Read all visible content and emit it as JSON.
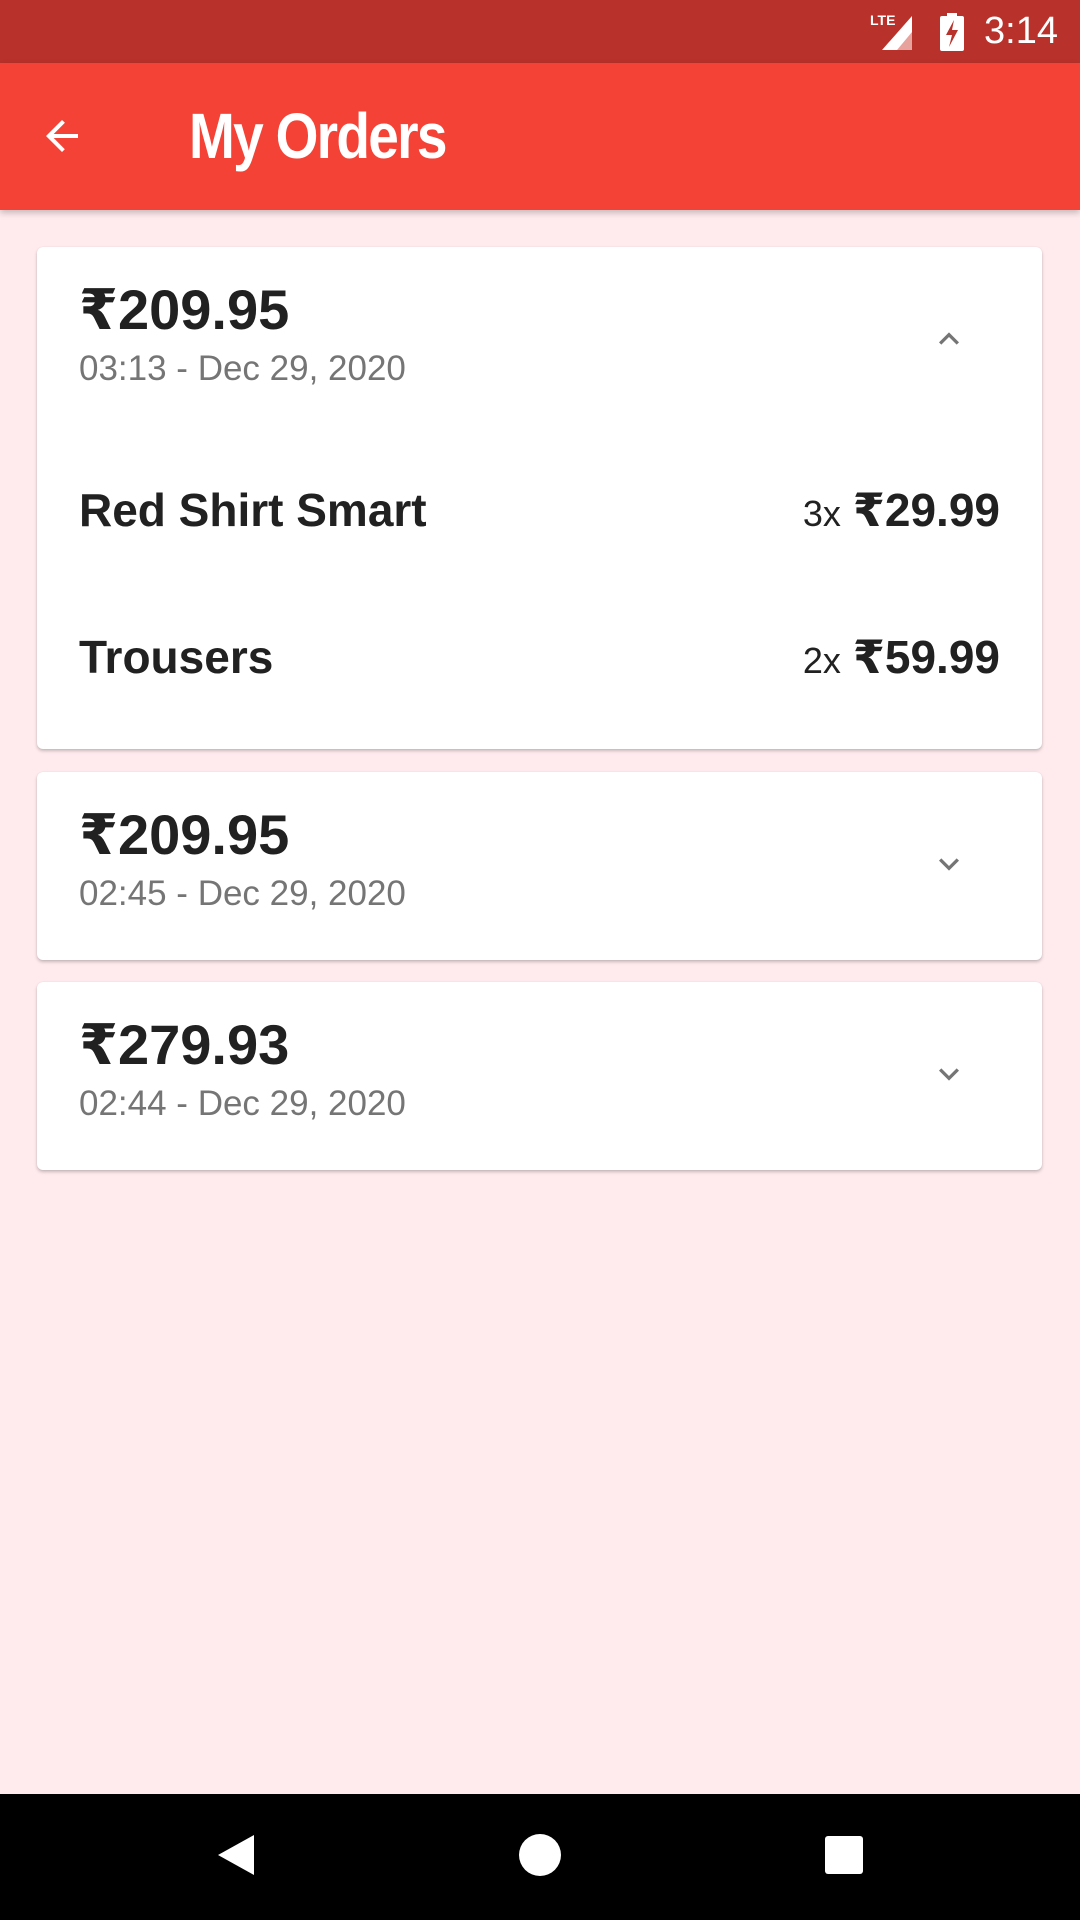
{
  "status_bar": {
    "network_label": "LTE",
    "time": "3:14",
    "icons": [
      "lte-signal-icon",
      "battery-charging-icon"
    ]
  },
  "app_bar": {
    "title": "My Orders",
    "back_icon": "arrow-back-icon",
    "background_color": "#F44336"
  },
  "orders": [
    {
      "total": "₹209.95",
      "datetime": "03:13 - Dec 29, 2020",
      "expanded": true,
      "toggle_icon": "chevron-up-icon",
      "items": [
        {
          "name": "Red Shirt Smart",
          "qty": "3x",
          "price": "₹29.99"
        },
        {
          "name": "Trousers",
          "qty": "2x",
          "price": "₹59.99"
        }
      ]
    },
    {
      "total": "₹209.95",
      "datetime": "02:45 - Dec 29, 2020",
      "expanded": false,
      "toggle_icon": "chevron-down-icon"
    },
    {
      "total": "₹279.93",
      "datetime": "02:44 - Dec 29, 2020",
      "expanded": false,
      "toggle_icon": "chevron-down-icon"
    }
  ],
  "nav_bar": {
    "icons": [
      "nav-back-icon",
      "nav-home-icon",
      "nav-recents-icon"
    ]
  },
  "colors": {
    "status_bar": "#B8312A",
    "accent": "#F44336",
    "page_background": "#FFEBEE"
  }
}
